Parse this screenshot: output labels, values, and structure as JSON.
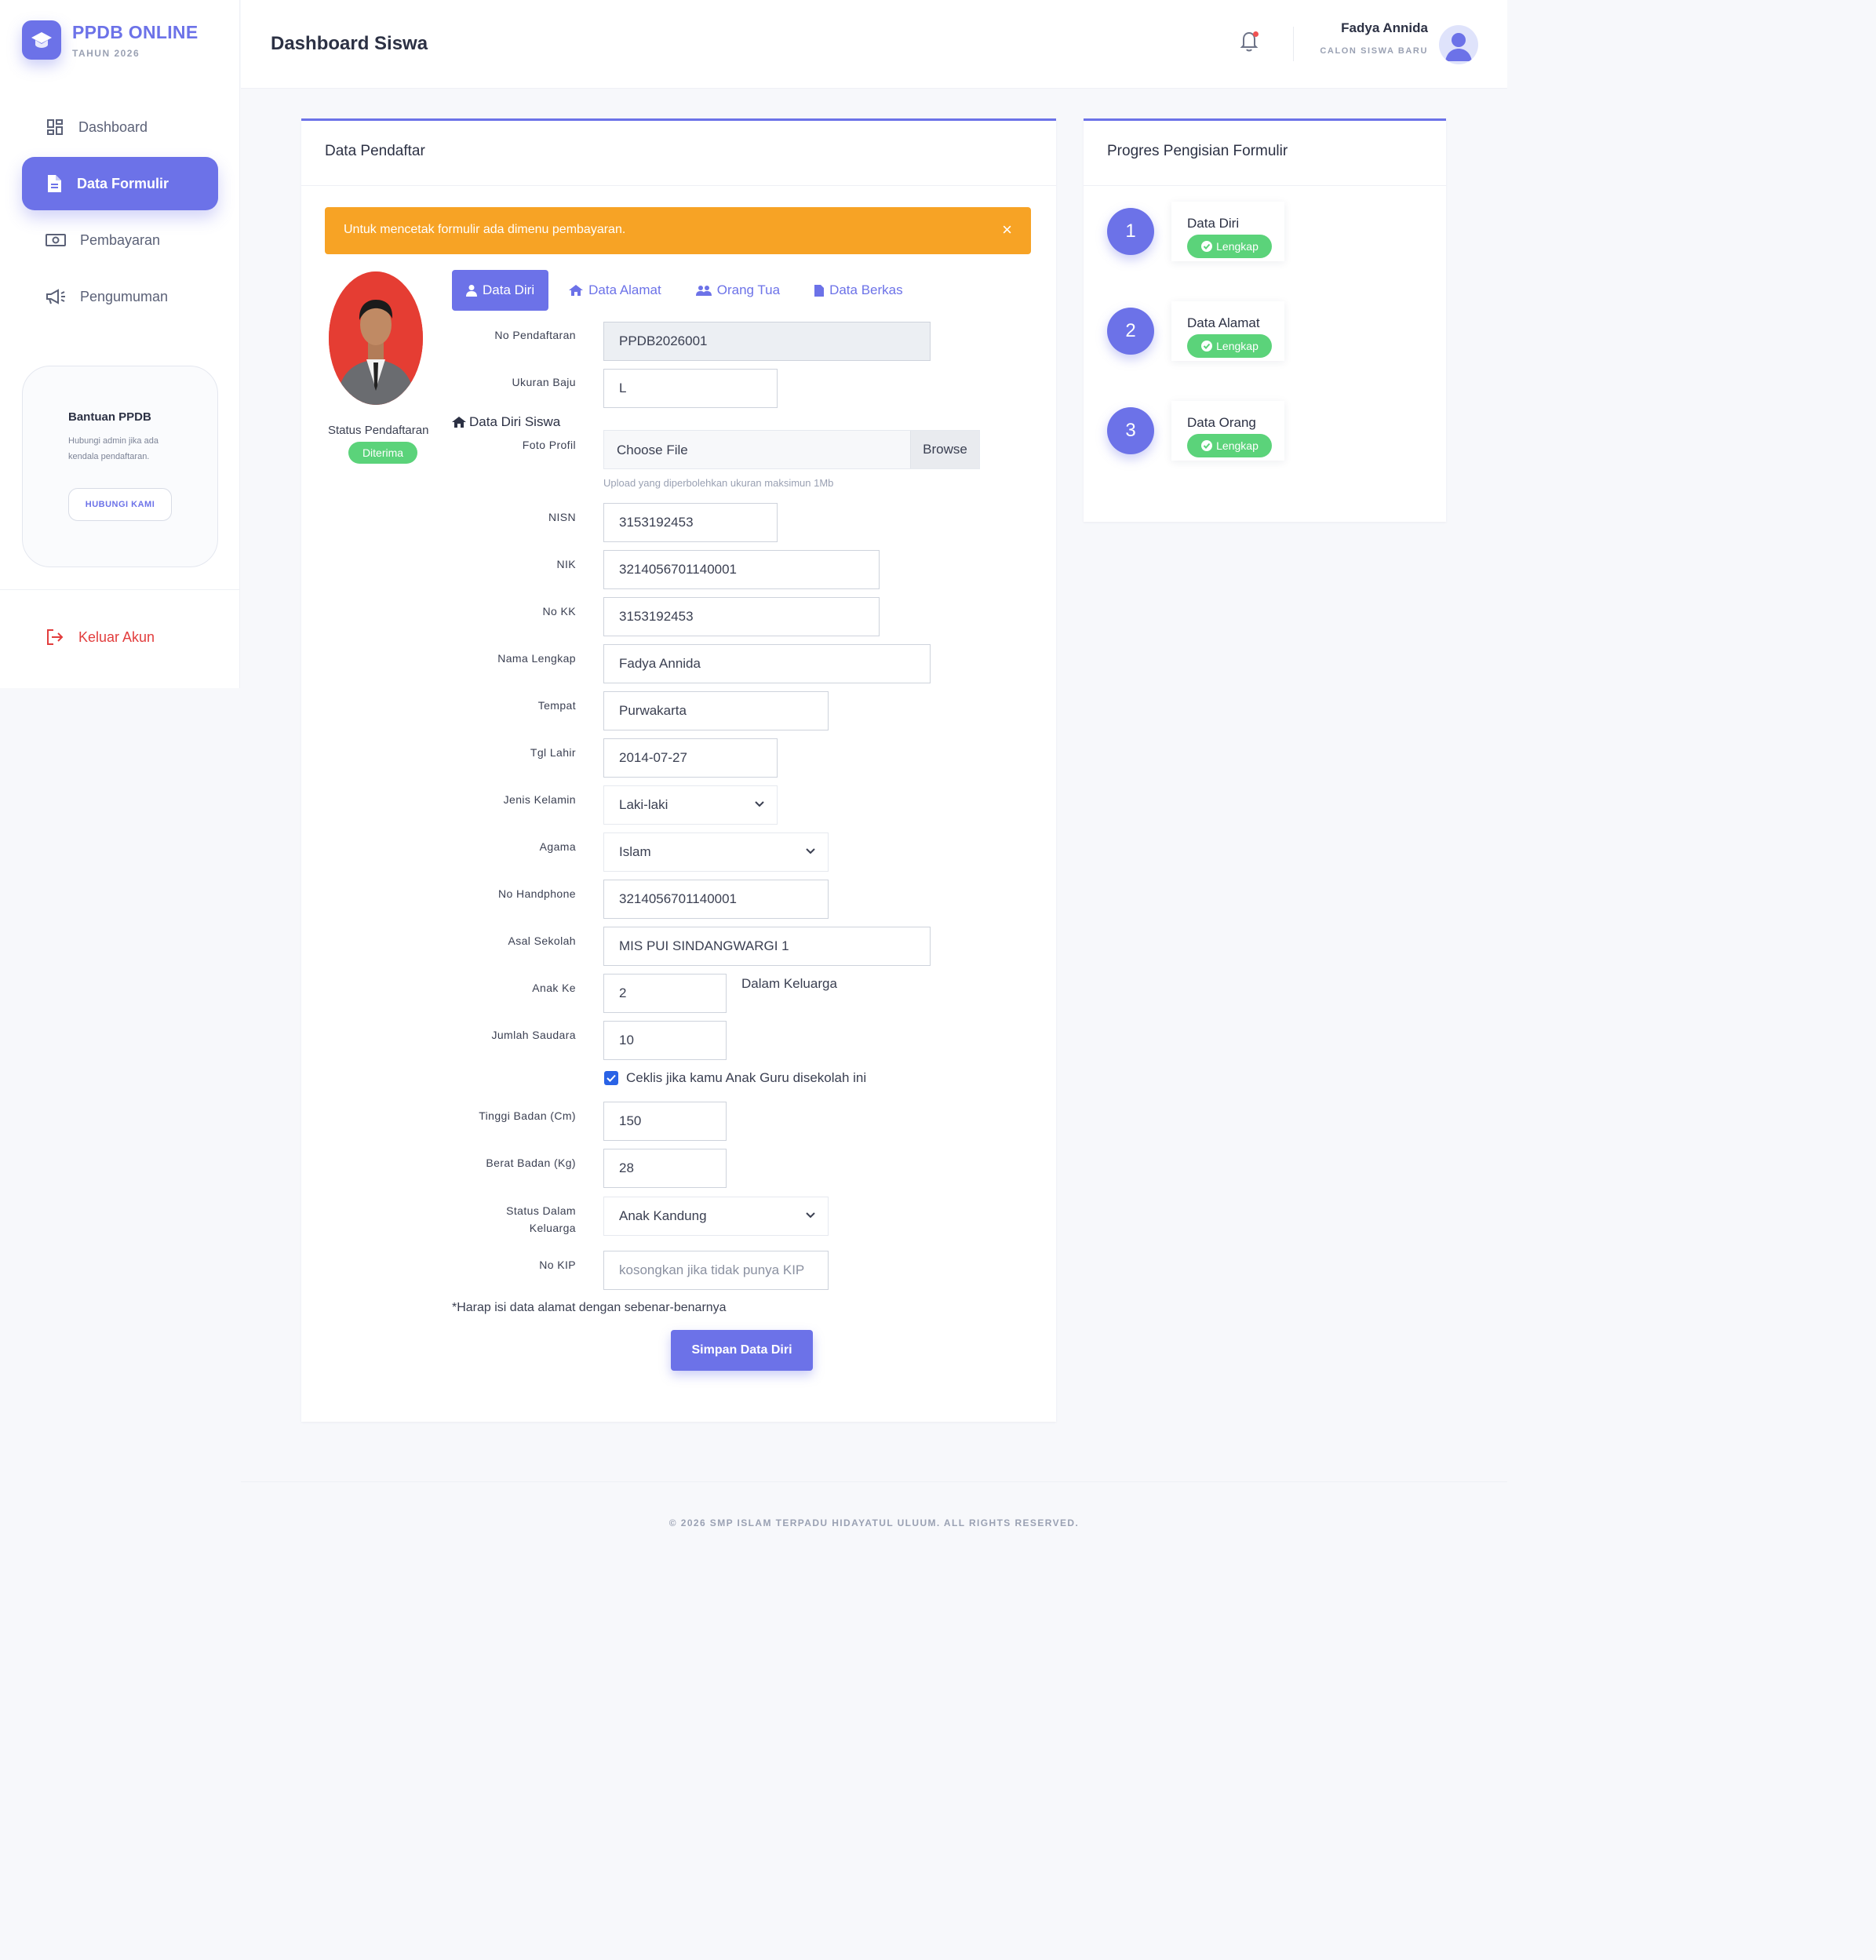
{
  "brand": {
    "title": "PPDB ONLINE",
    "subtitle": "TAHUN 2026"
  },
  "sidebar": {
    "items": [
      {
        "label": "Dashboard",
        "icon": "dashboard-icon",
        "active": false
      },
      {
        "label": "Data Formulir",
        "icon": "document-icon",
        "active": true
      },
      {
        "label": "Pembayaran",
        "icon": "money-icon",
        "active": false
      },
      {
        "label": "Pengumuman",
        "icon": "megaphone-icon",
        "active": false
      }
    ],
    "help": {
      "title": "Bantuan PPDB",
      "desc": "Hubungi admin jika ada kendala pendaftaran.",
      "button": "HUBUNGI KAMI"
    },
    "logout": "Keluar Akun"
  },
  "header": {
    "title": "Dashboard Siswa",
    "user_name": "Fadya Annida",
    "user_role": "CALON SISWA BARU"
  },
  "main_card": {
    "title": "Data Pendaftar",
    "alert": "Untuk mencetak formulir ada dimenu pembayaran.",
    "alert_close": "×",
    "status_label": "Status Pendaftaran",
    "status_value": "Diterima",
    "tabs": [
      {
        "label": "Data Diri"
      },
      {
        "label": "Data Alamat"
      },
      {
        "label": "Orang Tua"
      },
      {
        "label": "Data Berkas"
      }
    ],
    "section_title": "Data Diri Siswa",
    "fields": {
      "no_pendaftaran": {
        "label": "No Pendaftaran",
        "value": "PPDB2026001"
      },
      "ukuran_baju": {
        "label": "Ukuran Baju",
        "value": "L"
      },
      "foto_profil": {
        "label": "Foto Profil",
        "file_text": "Choose File",
        "browse": "Browse",
        "help": "Upload yang diperbolehkan ukuran maksimun 1Mb"
      },
      "nisn": {
        "label": "NISN",
        "value": "3153192453"
      },
      "nik": {
        "label": "NIK",
        "value": "3214056701140001"
      },
      "no_kk": {
        "label": "No KK",
        "value": "3153192453"
      },
      "nama_lengkap": {
        "label": "Nama Lengkap",
        "value": "Fadya Annida"
      },
      "tempat": {
        "label": "Tempat",
        "value": "Purwakarta"
      },
      "tgl_lahir": {
        "label": "Tgl Lahir",
        "value": "2014-07-27"
      },
      "jenis_kelamin": {
        "label": "Jenis Kelamin",
        "value": "Laki-laki"
      },
      "agama": {
        "label": "Agama",
        "value": "Islam"
      },
      "no_hp": {
        "label": "No Handphone",
        "value": "3214056701140001"
      },
      "asal_sekolah": {
        "label": "Asal Sekolah",
        "value": "MIS PUI SINDANGWARGI 1"
      },
      "anak_ke": {
        "label": "Anak Ke",
        "value": "2",
        "suffix": "Dalam Keluarga"
      },
      "jumlah_saudara": {
        "label": "Jumlah Saudara",
        "value": "10"
      },
      "anak_guru": {
        "label": "Ceklis jika kamu Anak Guru disekolah ini",
        "checked": true
      },
      "tinggi_badan": {
        "label": "Tinggi Badan (Cm)",
        "value": "150"
      },
      "berat_badan": {
        "label": "Berat Badan (Kg)",
        "value": "28"
      },
      "status_keluarga": {
        "label_1": "Status Dalam",
        "label_2": "Keluarga",
        "value": "Anak Kandung"
      },
      "no_kip": {
        "label": "No KIP",
        "placeholder": "kosongkan jika tidak punya KIP"
      }
    },
    "note": "*Harap isi data alamat dengan sebenar-benarnya",
    "save_button": "Simpan Data Diri"
  },
  "progress_card": {
    "title": "Progres Pengisian Formulir",
    "steps": [
      {
        "num": "1",
        "name": "Data Diri",
        "badge": "Lengkap"
      },
      {
        "num": "2",
        "name": "Data Alamat",
        "badge": "Lengkap"
      },
      {
        "num": "3",
        "name": "Data Orang",
        "badge": "Lengkap"
      }
    ]
  },
  "footer": "© 2026 SMP ISLAM TERPADU HIDAYATUL ULUUM. ALL RIGHTS RESERVED.",
  "colors": {
    "primary": "#6c72e8",
    "warning": "#f7a325",
    "success": "#5bd37a",
    "danger": "#e23d3d"
  }
}
